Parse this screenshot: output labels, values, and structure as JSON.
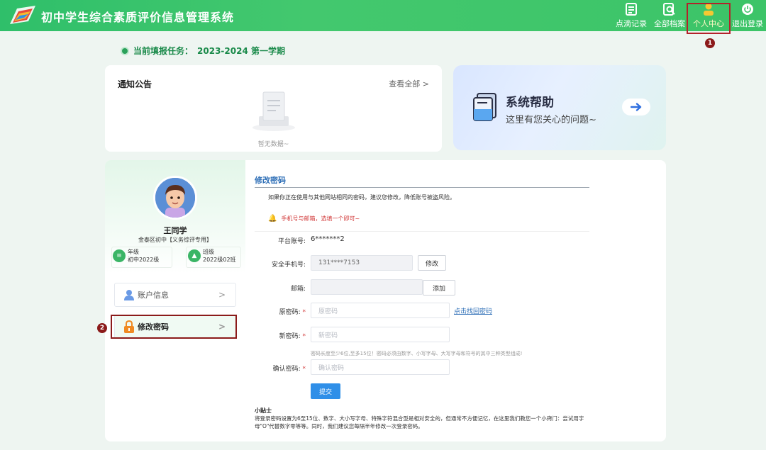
{
  "app": {
    "title": "初中学生综合素质评价信息管理系统"
  },
  "nav": {
    "items": [
      {
        "label": "点滴记录",
        "icon": "record-icon"
      },
      {
        "label": "全部档案",
        "icon": "archive-search-icon"
      },
      {
        "label": "个人中心",
        "icon": "user-icon"
      },
      {
        "label": "退出登录",
        "icon": "power-icon"
      }
    ]
  },
  "markers": {
    "one": "1",
    "two": "2"
  },
  "task": {
    "label": "当前填报任务：",
    "value": "2023-2024 第一学期"
  },
  "notice": {
    "title": "通知公告",
    "more": "查看全部 >",
    "empty": "暂无数据~"
  },
  "help": {
    "title": "系统帮助",
    "subtitle": "这里有您关心的问题~"
  },
  "profile": {
    "name": "王同学",
    "school": "金泰区初中【义务综评专用】",
    "grade_label": "年级",
    "grade_value": "初中2022级",
    "class_label": "班级",
    "class_value": "2022级02班"
  },
  "menu": {
    "account": "账户信息",
    "password": "修改密码",
    "arrow": ">"
  },
  "form": {
    "section_title": "修改密码",
    "hint": "如果你正在使用与其他网站相同的密码，建议您修改，降低账号被盗风险。",
    "warning": "手机号与邮箱，选填一个即可~",
    "account_label": "平台账号:",
    "account_value": "6*******2",
    "phone_label": "安全手机号:",
    "phone_value": "131****7153",
    "phone_btn": "修改",
    "email_label": "邮箱:",
    "email_btn": "添加",
    "old_label": "原密码:",
    "old_placeholder": "原密码",
    "forgot_link": "点击找回密码",
    "new_label": "新密码:",
    "new_placeholder": "新密码",
    "rule": "密码长度至少6位,至多15位！密码必须由数字、小写字母、大写字母和符号的其中三种类型组成!",
    "confirm_label": "确认密码:",
    "confirm_placeholder": "确认密码",
    "required": "*",
    "submit": "提交",
    "tips_title": "小贴士",
    "tips_body": "将登录密码设置为6至15位、数字、大小写字母、特殊字符混合型是相对安全的，但通常不方便记忆，在这里我们教您一个小窍门：尝试用字母\"O\"代替数字零等等。同时，我们建议您每隔半年修改一次登录密码。"
  },
  "colors": {
    "brand_green": "#3cc468",
    "accent_blue": "#2f8fe8",
    "highlight_red": "#8b1a1a"
  }
}
